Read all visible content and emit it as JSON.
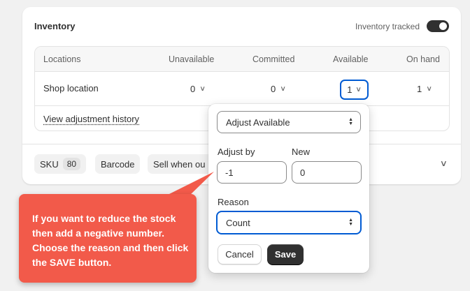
{
  "inventory": {
    "title": "Inventory",
    "tracked_label": "Inventory tracked",
    "tracked_on": true
  },
  "table": {
    "headers": [
      "Locations",
      "Unavailable",
      "Committed",
      "Available",
      "On hand"
    ],
    "row": {
      "location": "Shop location",
      "unavailable": "0",
      "committed": "0",
      "available": "1",
      "on_hand": "1"
    },
    "history_link": "View adjustment history"
  },
  "chips": {
    "sku_label": "SKU",
    "sku_value": "80",
    "barcode_label": "Barcode",
    "sell_label": "Sell when ou"
  },
  "popover": {
    "adjust_select": "Adjust Available",
    "adjust_by_label": "Adjust by",
    "adjust_by_value": "-1",
    "new_label": "New",
    "new_value": "0",
    "reason_label": "Reason",
    "reason_value": "Count",
    "cancel_label": "Cancel",
    "save_label": "Save"
  },
  "callout": {
    "text": "If you want to reduce the stock then add a negative number. Choose the reason and then click the SAVE button."
  },
  "colors": {
    "accent": "#005bd3",
    "callout": "#f25a4a",
    "dark_button": "#303030"
  }
}
